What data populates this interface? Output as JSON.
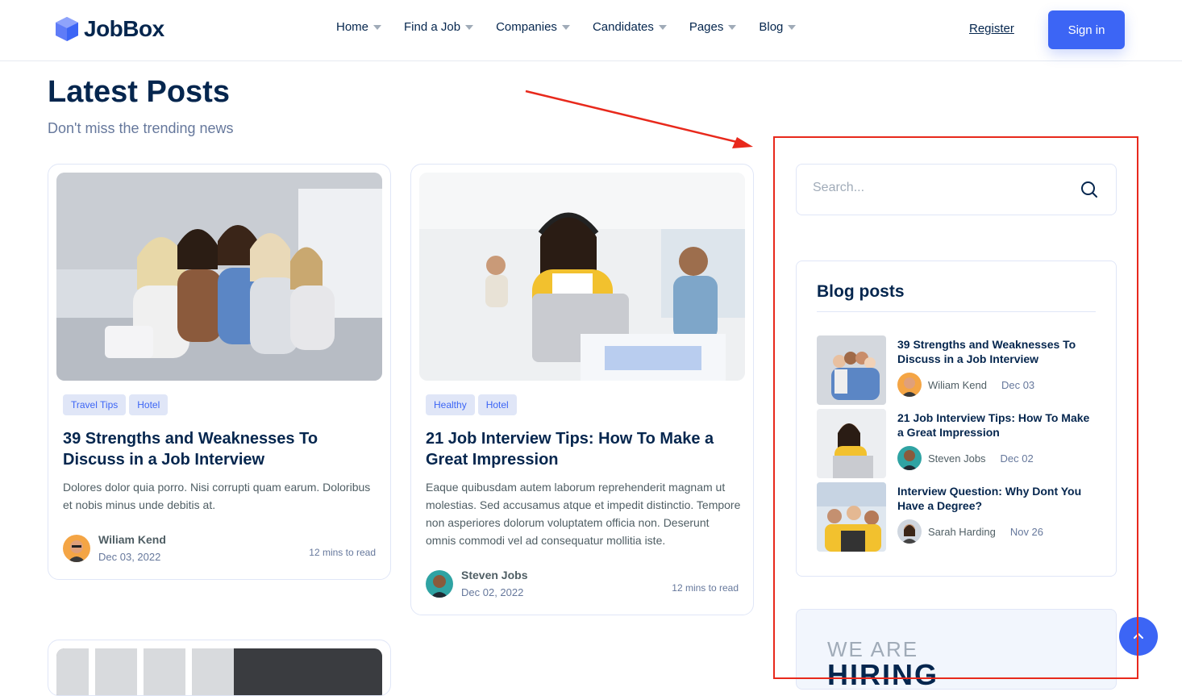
{
  "brand": {
    "name": "JobBox",
    "accent": "#3c65f5",
    "dark": "#05264e"
  },
  "nav": {
    "items": [
      "Home",
      "Find a Job",
      "Companies",
      "Candidates",
      "Pages",
      "Blog"
    ],
    "register": "Register",
    "signin": "Sign in"
  },
  "main": {
    "title": "Latest Posts",
    "subtitle": "Don't miss the trending news",
    "cards": [
      {
        "tags": [
          "Travel Tips",
          "Hotel"
        ],
        "title": "39 Strengths and Weaknesses To Discuss in a Job Interview",
        "text": "Dolores dolor quia porro. Nisi corrupti quam earum. Doloribus et nobis minus unde debitis at.",
        "author": "Wiliam Kend",
        "date": "Dec 03, 2022",
        "readtime": "12 mins to read"
      },
      {
        "tags": [
          "Healthy",
          "Hotel"
        ],
        "title": "21 Job Interview Tips: How To Make a Great Impression",
        "text": "Eaque quibusdam autem laborum reprehenderit magnam ut molestias. Sed accusamus atque et impedit distinctio. Tempore non asperiores dolorum voluptatem officia non. Deserunt omnis commodi vel ad consequatur mollitia iste.",
        "author": "Steven Jobs",
        "date": "Dec 02, 2022",
        "readtime": "12 mins to read"
      }
    ]
  },
  "sidebar": {
    "search_placeholder": "Search...",
    "blog_title": "Blog posts",
    "posts": [
      {
        "title": "39 Strengths and Weaknesses To Discuss in a Job Interview",
        "author": "Wiliam Kend",
        "date": "Dec 03"
      },
      {
        "title": "21 Job Interview Tips: How To Make a Great Impression",
        "author": "Steven Jobs",
        "date": "Dec 02"
      },
      {
        "title": "Interview Question: Why Dont You Have a Degree?",
        "author": "Sarah Harding",
        "date": "Nov 26"
      }
    ],
    "hiring_small": "WE ARE",
    "hiring_big": "HIRING"
  },
  "icons": [
    "logo-icon",
    "caret-down-icon",
    "search-icon",
    "arrow-up-icon"
  ],
  "annotation": {
    "color": "#e8291c"
  }
}
